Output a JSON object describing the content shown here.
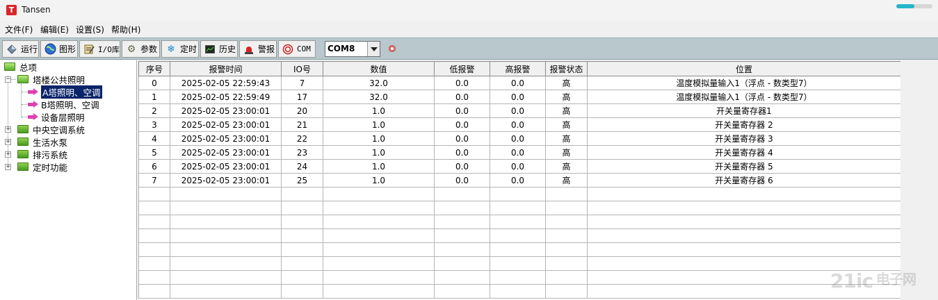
{
  "window": {
    "title": "Tansen",
    "app_icon_letter": "T",
    "progress": 0.5
  },
  "menu": [
    "文件(F)",
    "编辑(E)",
    "设置(S)",
    "帮助(H)"
  ],
  "toolbar": {
    "buttons": [
      {
        "label": "运行",
        "icon": "run-icon"
      },
      {
        "label": "图形",
        "icon": "globe-icon"
      },
      {
        "label": "I/O库",
        "icon": "io-library-icon"
      },
      {
        "label": "参数",
        "icon": "gear-icon"
      },
      {
        "label": "定时",
        "icon": "timer-icon"
      },
      {
        "label": "历史",
        "icon": "history-icon"
      },
      {
        "label": "警报",
        "icon": "alarm-light-icon"
      },
      {
        "label": "COM",
        "icon": "com-port-icon"
      }
    ],
    "com_port": "COM8"
  },
  "tree": {
    "root": "总项",
    "group": "塔楼公共照明",
    "children": [
      "A塔照明、空调",
      "B塔照明、空调",
      "设备层照明"
    ],
    "others": [
      "中央空调系统",
      "生活水泵",
      "排污系统",
      "定时功能"
    ]
  },
  "table": {
    "headers": [
      "序号",
      "报警时间",
      "IO号",
      "数值",
      "低报警",
      "高报警",
      "报警状态",
      "位置"
    ],
    "rows": [
      [
        "0",
        "2025-02-05 22:59:43",
        "7",
        "32.0",
        "0.0",
        "0.0",
        "高",
        "温度模拟量输入1（浮点 - 数类型7）"
      ],
      [
        "1",
        "2025-02-05 22:59:49",
        "17",
        "32.0",
        "0.0",
        "0.0",
        "高",
        "温度模拟量输入1（浮点 - 数类型7）"
      ],
      [
        "2",
        "2025-02-05 23:00:01",
        "20",
        "1.0",
        "0.0",
        "0.0",
        "高",
        "开关量寄存器1"
      ],
      [
        "3",
        "2025-02-05 23:00:01",
        "21",
        "1.0",
        "0.0",
        "0.0",
        "高",
        "开关量寄存器 2"
      ],
      [
        "4",
        "2025-02-05 23:00:01",
        "22",
        "1.0",
        "0.0",
        "0.0",
        "高",
        "开关量寄存器 3"
      ],
      [
        "5",
        "2025-02-05 23:00:01",
        "23",
        "1.0",
        "0.0",
        "0.0",
        "高",
        "开关量寄存器 4"
      ],
      [
        "6",
        "2025-02-05 23:00:01",
        "24",
        "1.0",
        "0.0",
        "0.0",
        "高",
        "开关量寄存器 5"
      ],
      [
        "7",
        "2025-02-05 23:00:01",
        "25",
        "1.0",
        "0.0",
        "0.0",
        "高",
        "开关量寄存器 6"
      ]
    ],
    "empty_rows": 8
  },
  "watermark": {
    "text": "21ic",
    "cn": "电子网"
  },
  "colors": {
    "toolbar_bg": "#b8c8cc",
    "selection": "#0a246a",
    "folder": "#58b027",
    "arrow": "#e040b0",
    "progress": "#26b5c9"
  }
}
